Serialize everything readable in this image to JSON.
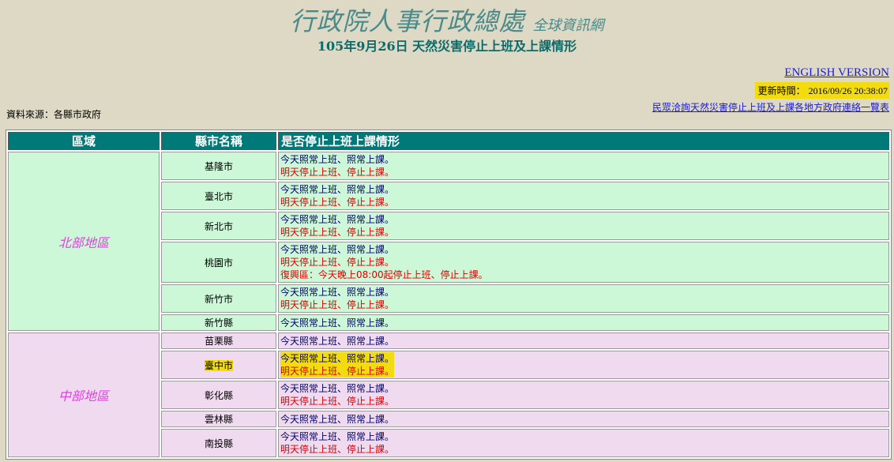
{
  "header": {
    "title": "行政院人事行政總處",
    "title_suffix": "全球資訊網",
    "subtitle": "105年9月26日 天然災害停止上班及上課情形"
  },
  "english_link": "ENGLISH VERSION",
  "update": {
    "label": "更新時間：",
    "value": "2016/09/26 20:38:07"
  },
  "source": "資料來源：各縣市政府",
  "contact_link": "民眾洽詢天然災害停止上班及上課各地方政府連絡一覽表",
  "table": {
    "headers": [
      "區域",
      "縣市名稱",
      "是否停止上班上課情形"
    ],
    "regions": [
      {
        "name": "北部地區",
        "rows": [
          {
            "city": "基隆市",
            "lines": [
              "今天照常上班、照常上課。",
              "明天停止上班、停止上課。"
            ]
          },
          {
            "city": "臺北市",
            "lines": [
              "今天照常上班、照常上課。",
              "明天停止上班、停止上課。"
            ]
          },
          {
            "city": "新北市",
            "lines": [
              "今天照常上班、照常上課。",
              "明天停止上班、停止上課。"
            ]
          },
          {
            "city": "桃園市",
            "lines": [
              "今天照常上班、照常上課。",
              "明天停止上班、停止上課。",
              "復興區：今天晚上08:00起停止上班、停止上課。"
            ]
          },
          {
            "city": "新竹市",
            "lines": [
              "今天照常上班、照常上課。",
              "明天停止上班、停止上課。"
            ]
          },
          {
            "city": "新竹縣",
            "lines": [
              "今天照常上班、照常上課。"
            ]
          }
        ]
      },
      {
        "name": "中部地區",
        "rows": [
          {
            "city": "苗栗縣",
            "lines": [
              "今天照常上班、照常上課。"
            ]
          },
          {
            "city": "臺中市",
            "lines": [
              "今天照常上班、照常上課。",
              "明天停止上班、停止上課。"
            ]
          },
          {
            "city": "彰化縣",
            "lines": [
              "今天照常上班、照常上課。",
              "明天停止上班、停止上課。"
            ]
          },
          {
            "city": "雲林縣",
            "lines": [
              "今天照常上班、照常上課。"
            ]
          },
          {
            "city": "南投縣",
            "lines": [
              "今天照常上班、照常上課。",
              "明天停止上班、停止上課。"
            ]
          }
        ]
      }
    ]
  },
  "colors": {
    "background": "#ddd9c4",
    "header_teal": "#007979",
    "north_row": "#ccf8d8",
    "central_row": "#f0daf0",
    "region_text": "#e040e0",
    "stop_text": "#dd0000",
    "highlight": "#f2dc10"
  }
}
